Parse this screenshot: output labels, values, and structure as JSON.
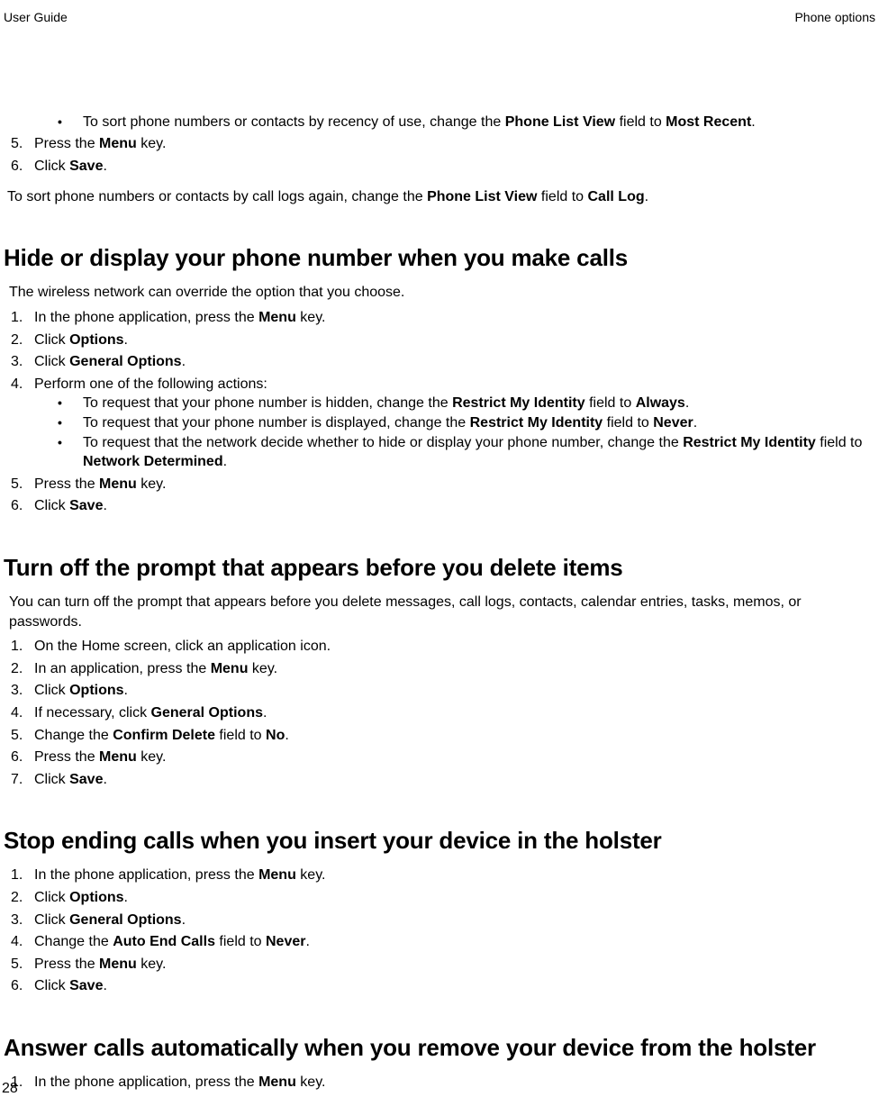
{
  "header": {
    "left": "User Guide",
    "right": "Phone options"
  },
  "page_number": "28",
  "topBullet": {
    "pre": "To sort phone numbers or contacts by recency of use, change the ",
    "b1": "Phone List View",
    "mid": " field to ",
    "b2": "Most Recent",
    "post": "."
  },
  "topSteps": [
    {
      "n": "5.",
      "pre": "Press the ",
      "b": "Menu",
      "post": " key."
    },
    {
      "n": "6.",
      "pre": "Click ",
      "b": "Save",
      "post": "."
    }
  ],
  "topPara": {
    "pre": "To sort phone numbers or contacts by call logs again, change the ",
    "b1": "Phone List View",
    "mid": " field to ",
    "b2": "Call Log",
    "post": "."
  },
  "sec1": {
    "title": "Hide or display your phone number when you make calls",
    "intro": "The wireless network can override the option that you choose.",
    "steps12": [
      {
        "n": "1.",
        "pre": "In the phone application, press the ",
        "b": "Menu",
        "post": " key."
      },
      {
        "n": "2.",
        "pre": "Click ",
        "b": "Options",
        "post": "."
      },
      {
        "n": "3.",
        "pre": "Click ",
        "b": "General Options",
        "post": "."
      },
      {
        "n": "4.",
        "pre": "Perform one of the following actions:",
        "b": "",
        "post": ""
      }
    ],
    "bullets": [
      {
        "pre": "To request that your phone number is hidden, change the ",
        "b1": "Restrict My Identity",
        "mid": " field to ",
        "b2": "Always",
        "post": "."
      },
      {
        "pre": "To request that your phone number is displayed, change the ",
        "b1": "Restrict My Identity",
        "mid": " field to ",
        "b2": "Never",
        "post": "."
      },
      {
        "pre": "To request that the network decide whether to hide or display your phone number, change the ",
        "b1": "Restrict My Identity",
        "mid": " field to ",
        "b2": "Network Determined",
        "post": "."
      }
    ],
    "steps56": [
      {
        "n": "5.",
        "pre": "Press the ",
        "b": "Menu",
        "post": " key."
      },
      {
        "n": "6.",
        "pre": "Click ",
        "b": "Save",
        "post": "."
      }
    ]
  },
  "sec2": {
    "title": "Turn off the prompt that appears before you delete items",
    "intro": "You can turn off the prompt that appears before you delete messages, call logs, contacts, calendar entries, tasks, memos, or passwords.",
    "steps": [
      {
        "n": "1.",
        "pre": "On the Home screen, click an application icon.",
        "b": "",
        "post": ""
      },
      {
        "n": "2.",
        "pre": "In an application, press the ",
        "b": "Menu",
        "post": " key."
      },
      {
        "n": "3.",
        "pre": "Click ",
        "b": "Options",
        "post": "."
      },
      {
        "n": "4.",
        "pre": "If necessary, click ",
        "b": "General Options",
        "post": "."
      },
      {
        "n": "5.",
        "pre": "Change the ",
        "b": "Confirm Delete",
        "mid": " field to ",
        "b2": "No",
        "post": "."
      },
      {
        "n": "6.",
        "pre": "Press the ",
        "b": "Menu",
        "post": " key."
      },
      {
        "n": "7.",
        "pre": "Click ",
        "b": "Save",
        "post": "."
      }
    ]
  },
  "sec3": {
    "title": "Stop ending calls when you insert your device in the holster",
    "steps": [
      {
        "n": "1.",
        "pre": "In the phone application, press the ",
        "b": "Menu",
        "post": " key."
      },
      {
        "n": "2.",
        "pre": "Click ",
        "b": "Options",
        "post": "."
      },
      {
        "n": "3.",
        "pre": "Click ",
        "b": "General Options",
        "post": "."
      },
      {
        "n": "4.",
        "pre": "Change the ",
        "b": "Auto End Calls",
        "mid": " field to ",
        "b2": "Never",
        "post": "."
      },
      {
        "n": "5.",
        "pre": "Press the ",
        "b": "Menu",
        "post": " key."
      },
      {
        "n": "6.",
        "pre": "Click ",
        "b": "Save",
        "post": "."
      }
    ]
  },
  "sec4": {
    "title": "Answer calls automatically when you remove your device from the holster",
    "steps": [
      {
        "n": "1.",
        "pre": "In the phone application, press the ",
        "b": "Menu",
        "post": " key."
      }
    ]
  }
}
